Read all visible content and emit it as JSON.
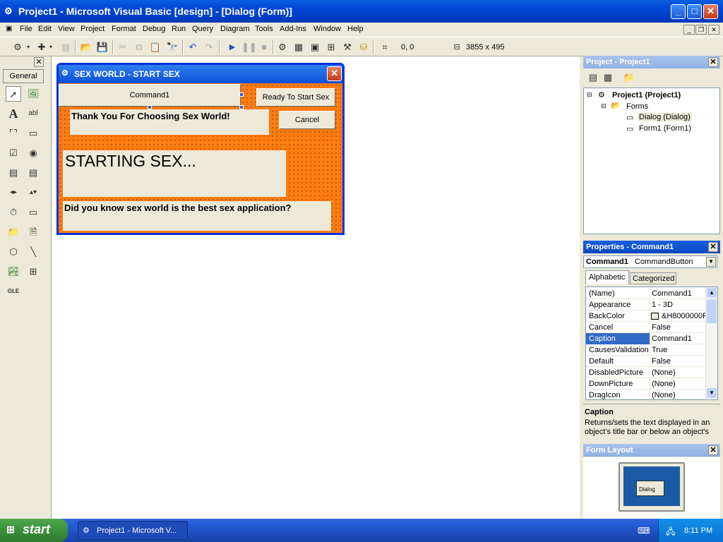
{
  "window": {
    "title": "Project1 - Microsoft Visual Basic [design] - [Dialog (Form)]",
    "app_icon": "vb-project-icon"
  },
  "menu": [
    "File",
    "Edit",
    "View",
    "Project",
    "Format",
    "Debug",
    "Run",
    "Query",
    "Diagram",
    "Tools",
    "Add-Ins",
    "Window",
    "Help"
  ],
  "toolbar": {
    "position": "0, 0",
    "size": "3855 x 495"
  },
  "toolbox": {
    "tab_label": "General"
  },
  "form": {
    "title": "SEX WORLD - START SEX",
    "command1": "Command1",
    "ready_button": "Ready To Start Sex",
    "thank_label": "Thank You For Choosing Sex World!",
    "cancel_button": "Cancel",
    "starting_label": "STARTING SEX...",
    "did_you_know": "Did you know sex world is the best sex application?"
  },
  "project_panel": {
    "title": "Project - Project1",
    "root": "Project1 (Project1)",
    "folder": "Forms",
    "items": [
      "Dialog (Dialog)",
      "Form1 (Form1)"
    ]
  },
  "properties_panel": {
    "title": "Properties - Command1",
    "object_name": "Command1",
    "object_type": "CommandButton",
    "tabs": [
      "Alphabetic",
      "Categorized"
    ],
    "rows": [
      {
        "name": "(Name)",
        "value": "Command1"
      },
      {
        "name": "Appearance",
        "value": "1 - 3D"
      },
      {
        "name": "BackColor",
        "value": "&H8000000F"
      },
      {
        "name": "Cancel",
        "value": "False"
      },
      {
        "name": "Caption",
        "value": "Command1"
      },
      {
        "name": "CausesValidation",
        "value": "True"
      },
      {
        "name": "Default",
        "value": "False"
      },
      {
        "name": "DisabledPicture",
        "value": "(None)"
      },
      {
        "name": "DownPicture",
        "value": "(None)"
      },
      {
        "name": "DragIcon",
        "value": "(None)"
      }
    ],
    "desc_title": "Caption",
    "desc_text": "Returns/sets the text displayed in an object's title bar or below an object's"
  },
  "form_layout": {
    "title": "Form Layout",
    "preview_label": "Dialog"
  },
  "taskbar": {
    "start": "start",
    "task": "Project1 - Microsoft V...",
    "clock": "8:11 PM"
  },
  "colors": {
    "form_back": "#ff7c10",
    "xp_blue": "#0a4fd6",
    "selection": "#316ac5"
  }
}
